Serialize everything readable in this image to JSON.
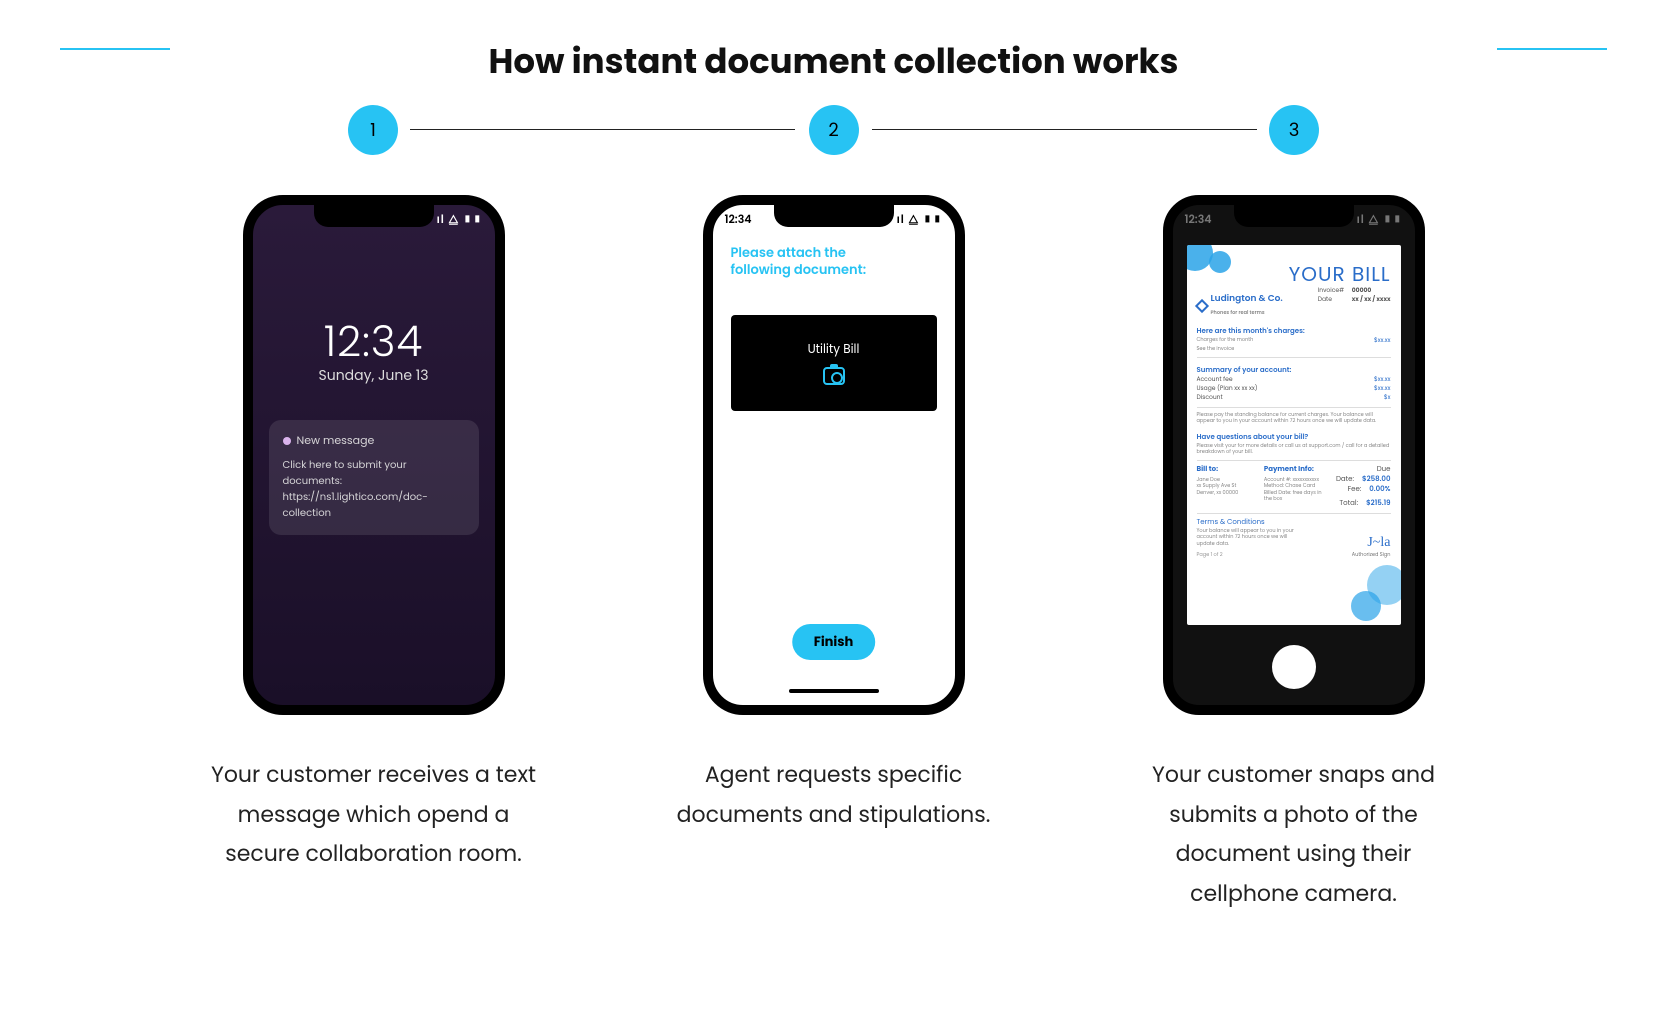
{
  "title": "How instant document collection works",
  "steps": {
    "s1": "1",
    "s2": "2",
    "s3": "3"
  },
  "captions": {
    "c1": "Your customer receives a text message which opend a secure collaboration room.",
    "c2": "Agent requests specific documents and stipulations.",
    "c3": "Your customer snaps and submits a photo of the document using their cellphone camera."
  },
  "phone_common": {
    "time": "12:34",
    "signal_icons": "ıl ⧋ ▮▮"
  },
  "phone1": {
    "clock": "12:34",
    "date": "Sunday, June 13",
    "notif_label": "New message",
    "notif_line1": "Click here to submit your documents:",
    "notif_line2": "https://ns1.lightico.com/doc-collection"
  },
  "phone2": {
    "prompt": "Please attach the\nfollowing document:",
    "doc_label": "Utility Bill",
    "finish": "Finish"
  },
  "phone3": {
    "bill_title": "YOUR BILL",
    "company": "Ludington & Co.",
    "tagline": "Phones for real terms",
    "meta": {
      "invoice_k": "Invoice#",
      "invoice_v": "00000",
      "date_k": "Date",
      "date_v": "xx / xx / xxxx"
    },
    "section_charges": "Here are this month's charges:",
    "charges_lines": [
      "Charges for the month",
      "See the invoice"
    ],
    "section_summary": "Summary of your account:",
    "summary_rows": [
      {
        "l": "Account fee",
        "v": "$xx.xx"
      },
      {
        "l": "Usage (Plan xx xx xx)",
        "v": "$xx.xx"
      },
      {
        "l": "Discount",
        "v": "$x"
      }
    ],
    "disclaimer": "Please pay the standing balance for current charges. Your balance will appear to you in your account within 72 hours once we will update data.",
    "section_questions": "Have questions about your bill?",
    "questions_text": "Please visit your for more details or call us at support.com / call for a detailed breakdown of your bill.",
    "billto_title": "Bill to:",
    "billto_lines": [
      "Jane Doe",
      "xx Supply Ave St",
      "Denver, xx 00000"
    ],
    "payinfo_title": "Payment Info:",
    "payinfo_lines": [
      "Account #: xxxxxxxxxxx",
      "Method: Chase Card",
      "Billed Date: free days in the box"
    ],
    "totals": {
      "due_lbl": "Due Date:",
      "due_val": "$258.00",
      "fee_lbl": "Fee:",
      "fee_val": "0.00%",
      "total_lbl": "Total:",
      "total_val": "$215.19"
    },
    "terms_title": "Terms & Conditions",
    "terms_text": "Your balance will appear to you in your account within 72 hours once we will update data.",
    "page": "Page 1 of 2",
    "sign_label": "Authorized Sign"
  }
}
